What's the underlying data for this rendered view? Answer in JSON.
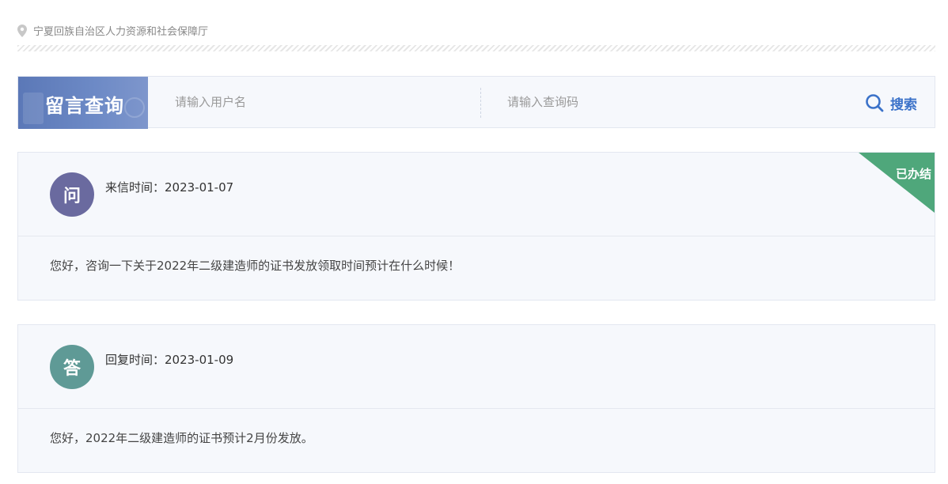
{
  "breadcrumb": {
    "icon": "location-pin-icon",
    "text": "宁夏回族自治区人力资源和社会保障厅"
  },
  "search": {
    "banner_title": "留言查询",
    "username_placeholder": "请输入用户名",
    "code_placeholder": "请输入查询码",
    "button_label": "搜索",
    "accent_color": "#3b72c9"
  },
  "question": {
    "avatar_label": "问",
    "time_label": "来信时间：2023-01-07",
    "status": "已办结",
    "status_color": "#4fa77b",
    "content": "您好，咨询一下关于2022年二级建造师的证书发放领取时间预计在什么时候！"
  },
  "answer": {
    "avatar_label": "答",
    "time_label": "回复时间：2023-01-09",
    "content": "您好，2022年二级建造师的证书预计2月份发放。"
  }
}
